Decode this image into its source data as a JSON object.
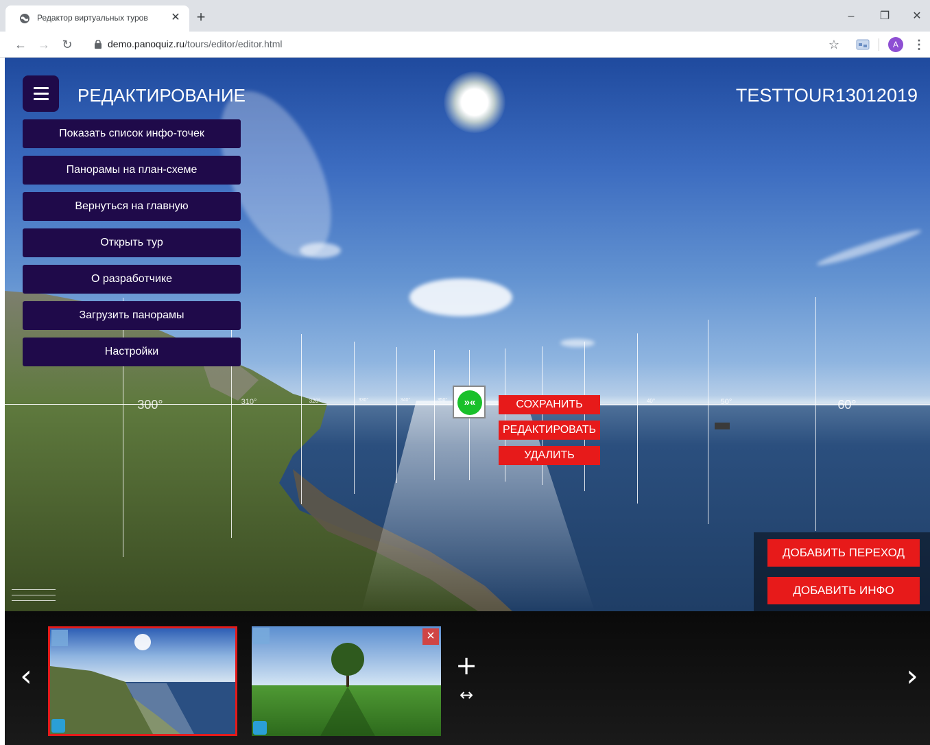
{
  "browser": {
    "tab_title": "Редактор виртуальных туров",
    "tab_close": "✕",
    "new_tab": "+",
    "url_host": "demo.panoquiz.ru",
    "url_path": "/tours/editor/editor.html",
    "avatar_letter": "A",
    "window": {
      "minimize": "–",
      "restore": "❐",
      "close": "✕"
    }
  },
  "editor": {
    "mode_title": "РЕДАКТИРОВАНИЕ",
    "tour_name": "TESTTOUR13012019",
    "menu": [
      {
        "label": "Показать список инфо-точек"
      },
      {
        "label": "Панорамы на план-схеме"
      },
      {
        "label": "Вернуться на главную"
      },
      {
        "label": "Открыть тур"
      },
      {
        "label": "О разработчике"
      },
      {
        "label": "Загрузить панорамы"
      },
      {
        "label": "Настройки"
      }
    ],
    "degree_labels": [
      "300°",
      "310°",
      "320°",
      "330°",
      "340°",
      "350°",
      "40°",
      "50°",
      "60°"
    ],
    "hotspot_symbol": "»«",
    "context_menu": {
      "save": "СОХРАНИТЬ",
      "edit": "РЕДАКТИРОВАТЬ",
      "delete": "УДАЛИТЬ"
    },
    "actions": {
      "add_transition": "ДОБАВИТЬ ПЕРЕХОД",
      "add_info": "ДОБАВИТЬ ИНФО"
    }
  },
  "strip": {
    "prev": "‹",
    "next": "›",
    "add": "+",
    "swap": "↔",
    "thumbnails": [
      {
        "scene": "sea-coast",
        "active": true
      },
      {
        "scene": "green-field-tree",
        "active": false
      }
    ]
  },
  "colors": {
    "menu_bg": "#1f0a4a",
    "action_red": "#e71a1a",
    "hotspot_green": "#19c02a",
    "active_thumb_border": "#e31b1b"
  }
}
